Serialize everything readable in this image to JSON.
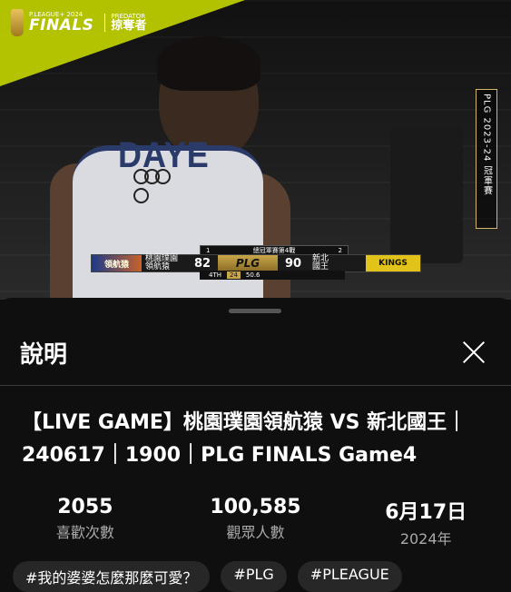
{
  "video": {
    "overlay_finals_small": "P.LEAGUE+ 2024",
    "overlay_finals_big": "FINALS",
    "sponsor_small": "PREDATOR",
    "sponsor_big": "掠奪者",
    "jersey_name": "DAYE",
    "side_banner": "PLG 2023-24 冠軍賽",
    "scoreboard": {
      "series_left": "1",
      "series_right": "2",
      "series_label": "總冠軍賽第4戰",
      "home_logo": "領航猿",
      "home_name_line1": "桃園璞園",
      "home_name_line2": "領航猿",
      "home_score": "82",
      "league": "PLG",
      "away_score": "90",
      "away_name_line1": "新北",
      "away_name_line2": "國王",
      "away_logo": "KINGS",
      "quarter": "4TH",
      "shot_clock": "24",
      "game_clock": "50.6"
    }
  },
  "sheet": {
    "title": "說明",
    "video_title": "【LIVE GAME】桃園璞園領航猿 VS 新北國王｜240617｜1900｜PLG FINALS Game4",
    "stats": [
      {
        "value": "2055",
        "label": "喜歡次數"
      },
      {
        "value": "100,585",
        "label": "觀眾人數"
      },
      {
        "value": "6月17日",
        "label": "2024年"
      }
    ],
    "chips": [
      "#我的婆婆怎麼那麼可愛？",
      "#PLG",
      "#PLEAGUE"
    ]
  }
}
